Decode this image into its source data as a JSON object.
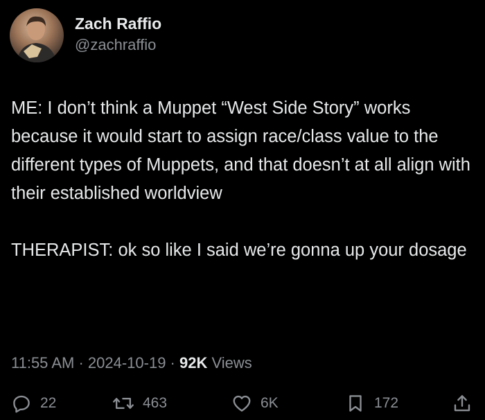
{
  "author": {
    "display_name": "Zach Raffio",
    "handle": "@zachraffio"
  },
  "tweet": {
    "paragraphs": [
      "ME: I don’t think a Muppet “West Side Story” works because it would start to assign race/class value to the different types of Muppets, and that doesn’t at all align with their established worldview",
      "THERAPIST: ok so like I said we’re gonna up your dosage"
    ]
  },
  "meta": {
    "time": "11:55 AM",
    "separator": " · ",
    "date": "2024-10-19",
    "views_count": "92K",
    "views_label": " Views"
  },
  "actions": {
    "replies": "22",
    "reposts": "463",
    "likes": "6K",
    "bookmarks": "172"
  },
  "colors": {
    "background": "#000000",
    "text": "#e7e9ea",
    "secondary": "#8b8f94"
  }
}
